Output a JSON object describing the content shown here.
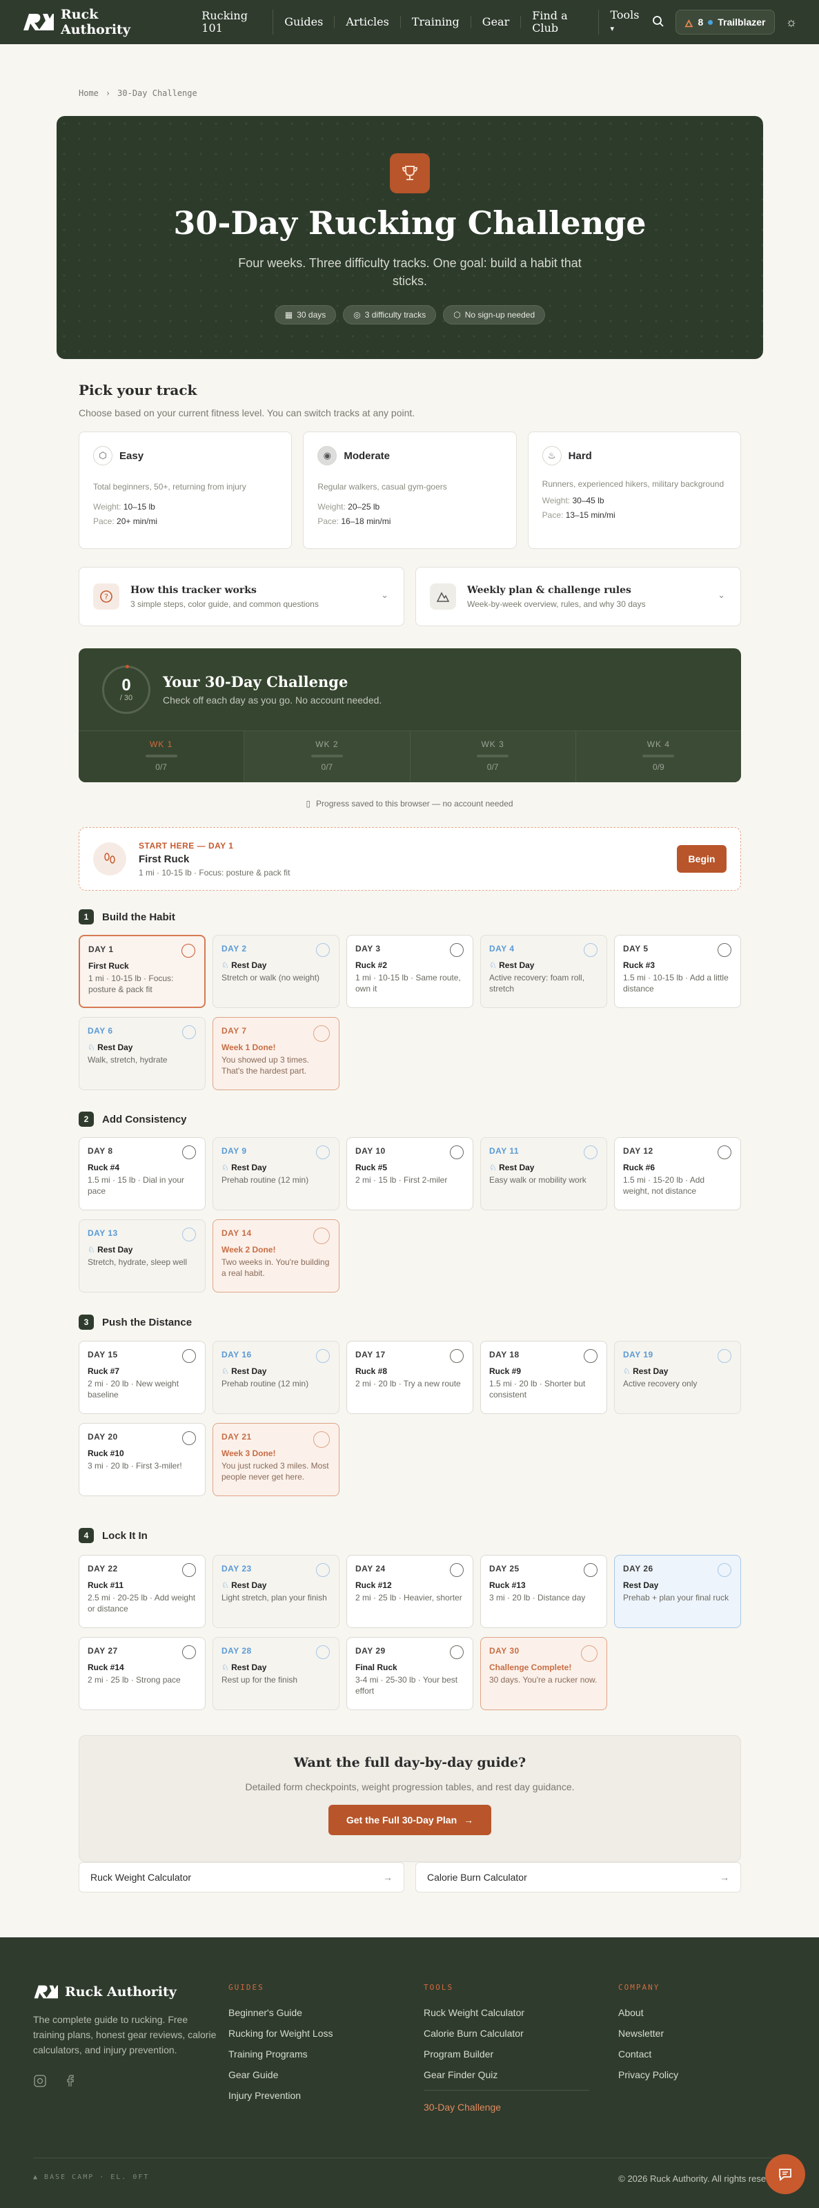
{
  "nav": {
    "brand": "Ruck Authority",
    "links": [
      "Rucking 101",
      "Guides",
      "Articles",
      "Training",
      "Gear",
      "Find a Club",
      "Tools"
    ],
    "streak": "8",
    "rank": "Trailblazer"
  },
  "breadcrumb": {
    "home": "Home",
    "current": "30-Day Challenge"
  },
  "hero": {
    "title": "30-Day Rucking Challenge",
    "subtitle": "Four weeks. Three difficulty tracks. One goal: build a habit that sticks.",
    "pills": [
      "30 days",
      "3 difficulty tracks",
      "No sign-up needed"
    ]
  },
  "tracks": {
    "title": "Pick your track",
    "subtitle": "Choose based on your current fitness level. You can switch tracks at any point.",
    "weight_label": "Weight:",
    "pace_label": "Pace:",
    "items": [
      {
        "name": "Easy",
        "desc": "Total beginners, 50+, returning from injury",
        "weight": "10–15 lb",
        "pace": "20+ min/mi"
      },
      {
        "name": "Moderate",
        "desc": "Regular walkers, casual gym-goers",
        "weight": "20–25 lb",
        "pace": "16–18 min/mi"
      },
      {
        "name": "Hard",
        "desc": "Runners, experienced hikers, military background",
        "weight": "30–45 lb",
        "pace": "13–15 min/mi"
      }
    ]
  },
  "accordions": [
    {
      "title": "How this tracker works",
      "subtitle": "3 simple steps, color guide, and common questions"
    },
    {
      "title": "Weekly plan & challenge rules",
      "subtitle": "Week-by-week overview, rules, and why 30 days"
    }
  ],
  "tracker": {
    "count": "0",
    "total": "/ 30",
    "title": "Your 30-Day Challenge",
    "subtitle": "Check off each day as you go. No account needed.",
    "weeks": [
      {
        "label": "WK 1",
        "count": "0/7"
      },
      {
        "label": "WK 2",
        "count": "0/7"
      },
      {
        "label": "WK 3",
        "count": "0/7"
      },
      {
        "label": "WK 4",
        "count": "0/9"
      }
    ],
    "saved_note": "Progress saved to this browser — no account needed"
  },
  "start": {
    "kicker": "START HERE — DAY 1",
    "title": "First Ruck",
    "detail": "1 mi · 10-15 lb · Focus: posture & pack fit",
    "button": "Begin"
  },
  "phases": [
    {
      "num": "1",
      "title": "Build the Habit",
      "days": [
        {
          "day": "DAY 1",
          "title": "First Ruck",
          "detail": "1 mi · 10-15 lb · Focus: posture & pack fit",
          "kind": "today"
        },
        {
          "day": "DAY 2",
          "title": "Rest Day",
          "detail": "Stretch or walk (no weight)",
          "kind": "rest"
        },
        {
          "day": "DAY 3",
          "title": "Ruck #2",
          "detail": "1 mi · 10-15 lb · Same route, own it",
          "kind": "ruck"
        },
        {
          "day": "DAY 4",
          "title": "Rest Day",
          "detail": "Active recovery: foam roll, stretch",
          "kind": "rest"
        },
        {
          "day": "DAY 5",
          "title": "Ruck #3",
          "detail": "1.5 mi · 10-15 lb · Add a little distance",
          "kind": "ruck"
        },
        {
          "day": "DAY 6",
          "title": "Rest Day",
          "detail": "Walk, stretch, hydrate",
          "kind": "rest"
        },
        {
          "day": "DAY 7",
          "title": "Week 1 Done!",
          "detail": "You showed up 3 times. That's the hardest part.",
          "kind": "milestone"
        }
      ]
    },
    {
      "num": "2",
      "title": "Add Consistency",
      "days": [
        {
          "day": "DAY 8",
          "title": "Ruck #4",
          "detail": "1.5 mi · 15 lb · Dial in your pace",
          "kind": "ruck"
        },
        {
          "day": "DAY 9",
          "title": "Rest Day",
          "detail": "Prehab routine (12 min)",
          "kind": "rest"
        },
        {
          "day": "DAY 10",
          "title": "Ruck #5",
          "detail": "2 mi · 15 lb · First 2-miler",
          "kind": "ruck"
        },
        {
          "day": "DAY 11",
          "title": "Rest Day",
          "detail": "Easy walk or mobility work",
          "kind": "rest"
        },
        {
          "day": "DAY 12",
          "title": "Ruck #6",
          "detail": "1.5 mi · 15-20 lb · Add weight, not distance",
          "kind": "ruck"
        },
        {
          "day": "DAY 13",
          "title": "Rest Day",
          "detail": "Stretch, hydrate, sleep well",
          "kind": "rest"
        },
        {
          "day": "DAY 14",
          "title": "Week 2 Done!",
          "detail": "Two weeks in. You're building a real habit.",
          "kind": "milestone"
        }
      ]
    },
    {
      "num": "3",
      "title": "Push the Distance",
      "days": [
        {
          "day": "DAY 15",
          "title": "Ruck #7",
          "detail": "2 mi · 20 lb · New weight baseline",
          "kind": "ruck"
        },
        {
          "day": "DAY 16",
          "title": "Rest Day",
          "detail": "Prehab routine (12 min)",
          "kind": "rest"
        },
        {
          "day": "DAY 17",
          "title": "Ruck #8",
          "detail": "2 mi · 20 lb · Try a new route",
          "kind": "ruck"
        },
        {
          "day": "DAY 18",
          "title": "Ruck #9",
          "detail": "1.5 mi · 20 lb · Shorter but consistent",
          "kind": "ruck"
        },
        {
          "day": "DAY 19",
          "title": "Rest Day",
          "detail": "Active recovery only",
          "kind": "rest"
        },
        {
          "day": "DAY 20",
          "title": "Ruck #10",
          "detail": "3 mi · 20 lb · First 3-miler!",
          "kind": "ruck"
        },
        {
          "day": "DAY 21",
          "title": "Week 3 Done!",
          "detail": "You just rucked 3 miles. Most people never get here.",
          "kind": "milestone"
        }
      ]
    },
    {
      "num": "4",
      "title": "Lock It In",
      "days": [
        {
          "day": "DAY 22",
          "title": "Ruck #11",
          "detail": "2.5 mi · 20-25 lb · Add weight or distance",
          "kind": "ruck"
        },
        {
          "day": "DAY 23",
          "title": "Rest Day",
          "detail": "Light stretch, plan your finish",
          "kind": "rest"
        },
        {
          "day": "DAY 24",
          "title": "Ruck #12",
          "detail": "2 mi · 25 lb · Heavier, shorter",
          "kind": "ruck"
        },
        {
          "day": "DAY 25",
          "title": "Ruck #13",
          "detail": "3 mi · 20 lb · Distance day",
          "kind": "ruck"
        },
        {
          "day": "DAY 26",
          "title": "Rest Day",
          "detail": "Prehab + plan your final ruck",
          "kind": "hl"
        },
        {
          "day": "DAY 27",
          "title": "Ruck #14",
          "detail": "2 mi · 25 lb · Strong pace",
          "kind": "ruck"
        },
        {
          "day": "DAY 28",
          "title": "Rest Day",
          "detail": "Rest up for the finish",
          "kind": "rest"
        },
        {
          "day": "DAY 29",
          "title": "Final Ruck",
          "detail": "3-4 mi · 25-30 lb · Your best effort",
          "kind": "ruck"
        },
        {
          "day": "DAY 30",
          "title": "Challenge Complete!",
          "detail": "30 days. You're a rucker now.",
          "kind": "milestone"
        }
      ]
    }
  ],
  "cta": {
    "title": "Want the full day-by-day guide?",
    "subtitle": "Detailed form checkpoints, weight progression tables, and rest day guidance.",
    "button": "Get the Full 30-Day Plan"
  },
  "tool_links": [
    "Ruck Weight Calculator",
    "Calorie Burn Calculator"
  ],
  "footer": {
    "brand": "Ruck Authority",
    "tagline": "The complete guide to rucking. Free training plans, honest gear reviews, calorie calculators, and injury prevention.",
    "cols": [
      {
        "heading": "GUIDES",
        "items": [
          "Beginner's Guide",
          "Rucking for Weight Loss",
          "Training Programs",
          "Gear Guide",
          "Injury Prevention"
        ]
      },
      {
        "heading": "TOOLS",
        "items": [
          "Ruck Weight Calculator",
          "Calorie Burn Calculator",
          "Program Builder",
          "Gear Finder Quiz"
        ],
        "extra": "30-Day Challenge"
      },
      {
        "heading": "COMPANY",
        "items": [
          "About",
          "Newsletter",
          "Contact",
          "Privacy Policy"
        ]
      }
    ],
    "coords": "BASE CAMP · EL. 0FT",
    "copyright": "© 2026 Ruck Authority. All rights reserved."
  },
  "colors": {
    "forest": "#2f3b2d",
    "accent": "#b8552a",
    "rest_blue": "#5a9ad6",
    "paper": "#f7f6f1"
  },
  "icons": [
    "logo-mark",
    "trophy-icon",
    "search-icon",
    "flame-icon",
    "sun-icon",
    "calendar-icon",
    "layers-icon",
    "shield-icon",
    "question-icon",
    "mountain-icon",
    "device-icon",
    "footprints-icon",
    "instagram-icon",
    "facebook-icon",
    "chat-icon",
    "arrow-right-icon"
  ]
}
